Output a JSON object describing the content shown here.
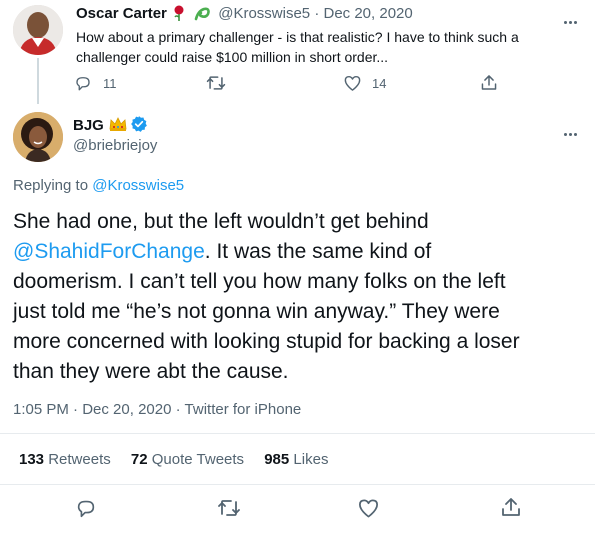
{
  "parent": {
    "name": "Oscar Carter",
    "name_emojis": "🌹 ☘",
    "handle": "@Krosswise5",
    "separator": "·",
    "date": "Dec 20, 2020",
    "text_line1": "How about a primary challenger - is that realistic? I have to think such a",
    "text_line2": "challenger could raise $100 million in short order...",
    "replies": "11",
    "likes": "14"
  },
  "tweet": {
    "name": "BJG",
    "name_emoji": "👑",
    "handle": "@briebriejoy",
    "replying_prefix": "Replying to",
    "replying_to": "@Krosswise5",
    "body": {
      "line1": "She had one, but the left wouldn’t get behind",
      "mention": "@ShahidForChange",
      "line2_rest": ". It was the same kind of",
      "line3": "doomerism. I can’t tell you how many folks on the left",
      "line4": "just told me “he’s not gonna win anyway.” They were",
      "line5": "more concerned with looking stupid for backing a loser",
      "line6": "than they were abt the cause."
    },
    "time": "1:05 PM",
    "dot1": "·",
    "date": "Dec 20, 2020",
    "dot2": "·",
    "source": "Twitter for iPhone",
    "retweets_count": "133",
    "retweets_label": "Retweets",
    "quotes_count": "72",
    "quotes_label": "Quote Tweets",
    "likes_count": "985",
    "likes_label": "Likes"
  },
  "colors": {
    "link": "#1d9bf0",
    "muted": "#536471",
    "verified": "#1d9bf0",
    "divider": "#e7ebee"
  },
  "icons": [
    "more-icon",
    "reply-icon",
    "retweet-icon",
    "like-icon",
    "share-icon",
    "verified-badge-icon",
    "crown-icon",
    "rose-icon",
    "shamrock-icon"
  ]
}
